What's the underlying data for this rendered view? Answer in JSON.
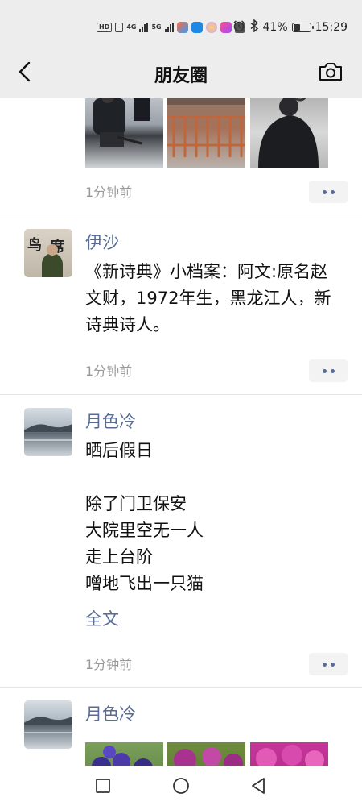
{
  "status_bar": {
    "left_badges": [
      "HD",
      "4G",
      "5G"
    ],
    "battery": "41%",
    "battery_level": 0.41,
    "time": "15:29"
  },
  "nav": {
    "title": "朋友圈",
    "back_icon": "chevron-left-icon",
    "camera_icon": "camera-icon"
  },
  "posts": [
    {
      "time": "1分钟前"
    },
    {
      "name": "伊沙",
      "content": "《新诗典》小档案：阿文:原名赵文财，1972年生，黑龙江人，新诗典诗人。",
      "time": "1分钟前"
    },
    {
      "name": "月色冷",
      "content": "晒后假日\n\n除了门卫保安\n大院里空无一人\n走上台阶\n噌地飞出一只猫",
      "full_text": "全文",
      "time": "1分钟前"
    },
    {
      "name": "月色冷"
    }
  ],
  "colors": {
    "link": "#576b95",
    "bar_bg": "#ededed",
    "timestamp": "#999999"
  }
}
